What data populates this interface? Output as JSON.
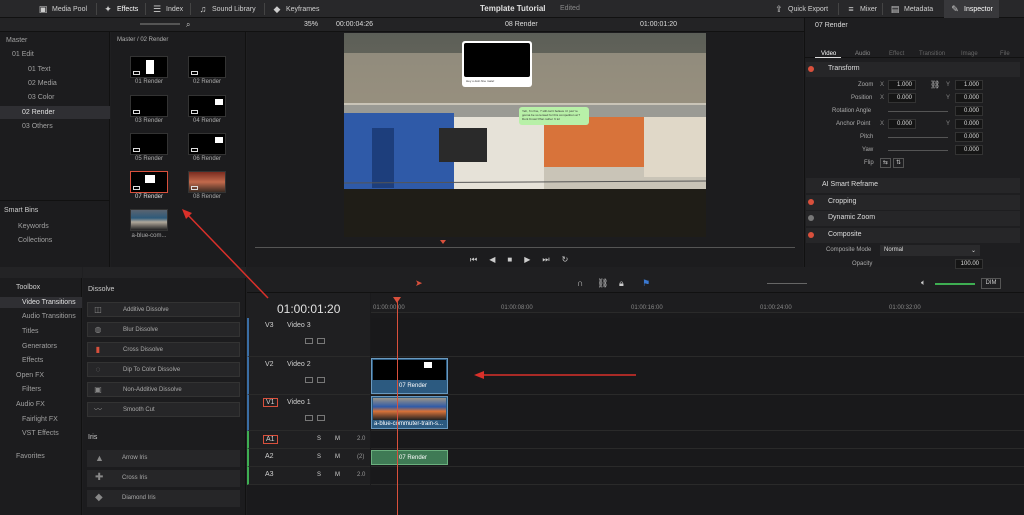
{
  "topbar": {
    "media_pool": "Media Pool",
    "effects": "Effects",
    "index": "Index",
    "sound_library": "Sound Library",
    "keyframes": "Keyframes",
    "title": "Template Tutorial",
    "edited": "Edited",
    "quick_export": "Quick Export",
    "mixer": "Mixer",
    "metadata": "Metadata",
    "inspector": "Inspector"
  },
  "viewer_bar": {
    "zoom": "35%",
    "duration": "00:00:04:26",
    "clip_name": "08 Render",
    "timecode": "01:00:01:20"
  },
  "bins": {
    "items": [
      "Master",
      "01 Edit",
      "01 Text",
      "02 Media",
      "03 Color",
      "02 Render",
      "03 Others"
    ],
    "smart_bins": "Smart Bins",
    "smart_items": [
      "Keywords",
      "Collections"
    ]
  },
  "media_pool": {
    "breadcrumb": "Master / 02 Render",
    "clips": [
      "01 Render",
      "02 Render",
      "03 Render",
      "04 Render",
      "05 Render",
      "06 Render",
      "07 Render",
      "08 Render",
      "a-blue-com..."
    ]
  },
  "video_overlay": {
    "bubble1": "Hey u doin fine mate!",
    "bubble2": "Yeh, I'm fine, ? still can't believe it I just 're gonna be so tensed for this competition at ? Dont Know! Plan rather 'it lol"
  },
  "inspector": {
    "clip_name": "07 Render",
    "tabs": [
      "Video",
      "Audio",
      "Effect",
      "Transition",
      "Image",
      "File"
    ],
    "transform": "Transform",
    "zoom_label": "Zoom",
    "zoom_x": "1.000",
    "zoom_y": "1.000",
    "position_label": "Position",
    "pos_x": "0.000",
    "pos_y": "0.000",
    "rotation_label": "Rotation Angle",
    "rotation": "0.000",
    "anchor_label": "Anchor Point",
    "anchor_x": "0.000",
    "anchor_y": "0.000",
    "pitch_label": "Pitch",
    "pitch": "0.000",
    "yaw_label": "Yaw",
    "yaw": "0.000",
    "flip_label": "Flip",
    "ai_smart": "AI Smart Reframe",
    "cropping": "Cropping",
    "dynamic_zoom": "Dynamic Zoom",
    "composite": "Composite",
    "composite_mode_label": "Composite Mode",
    "composite_mode": "Normal",
    "opacity_label": "Opacity",
    "opacity": "100.00",
    "x": "X",
    "y": "Y"
  },
  "effects_panel": {
    "toolbox": "Toolbox",
    "items": [
      "Video Transitions",
      "Audio Transitions",
      "Titles",
      "Generators",
      "Effects",
      "Open FX",
      "Filters",
      "Audio FX",
      "Fairlight FX",
      "VST Effects",
      "Favorites"
    ],
    "dissolve_header": "Dissolve",
    "dissolve_items": [
      "Additive Dissolve",
      "Blur Dissolve",
      "Cross Dissolve",
      "Dip To Color Dissolve",
      "Non-Additive Dissolve",
      "Smooth Cut"
    ],
    "iris_header": "Iris",
    "iris_items": [
      "Arrow Iris",
      "Cross Iris",
      "Diamond Iris"
    ]
  },
  "timeline": {
    "timecode": "01:00:01:20",
    "ruler": [
      "01:00:00:00",
      "01:00:08:00",
      "01:00:16:00",
      "01:00:24:00",
      "01:00:32:00"
    ],
    "tracks": [
      {
        "id": "V3",
        "name": "Video 3"
      },
      {
        "id": "V2",
        "name": "Video 2"
      },
      {
        "id": "V1",
        "name": "Video 1"
      },
      {
        "id": "A1",
        "name": "",
        "level": "2.0"
      },
      {
        "id": "A2",
        "name": "",
        "level": "(2)"
      },
      {
        "id": "A3",
        "name": "",
        "level": "2.0"
      }
    ],
    "clip_v2": "07 Render",
    "clip_v1": "a-blue-commuter-train-s...",
    "clip_a2": "07 Render",
    "dim": "DIM",
    "s_label": "S",
    "m_label": "M"
  },
  "colors": {
    "accent": "#d9503c",
    "clip_blue": "#2c5a80",
    "clip_green": "#3f7a55"
  }
}
